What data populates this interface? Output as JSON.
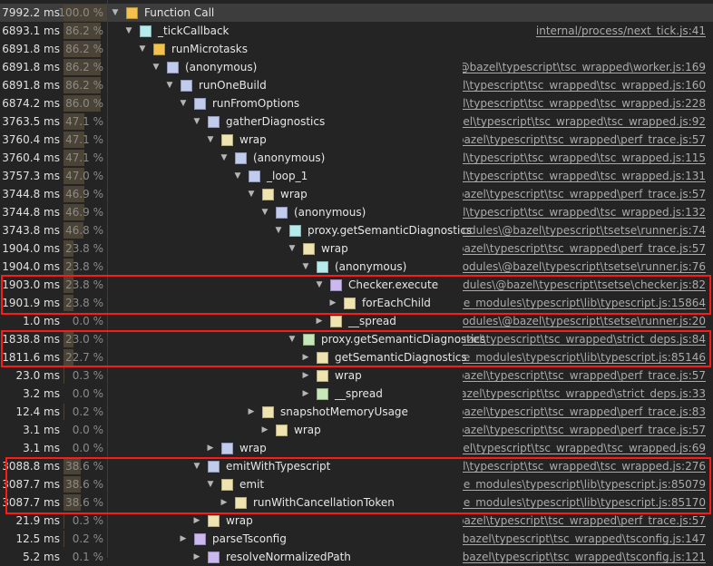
{
  "rows": [
    {
      "time": "7992.2 ms",
      "pct": "100.0 %",
      "pct_value": 100.0,
      "name": "Function Call",
      "src": "",
      "icon": "folder-yellow",
      "level": 0
    },
    {
      "time": "6893.1 ms",
      "pct": "86.2 %",
      "pct_value": 86.2,
      "name": "_tickCallback",
      "src": "internal/process/next_tick.js:41",
      "icon": "function-teal",
      "level": 1
    },
    {
      "time": "6891.8 ms",
      "pct": "86.2 %",
      "pct_value": 86.2,
      "name": "runMicrotasks",
      "src": "",
      "icon": "folder-yellow",
      "level": 2
    },
    {
      "time": "6891.8 ms",
      "pct": "86.2 %",
      "pct_value": 86.2,
      "name": "(anonymous)",
      "src": "les\\@bazel\\typescript\\tsc_wrapped\\worker.js:169",
      "icon": "function-blue",
      "level": 3
    },
    {
      "time": "6891.8 ms",
      "pct": "86.2 %",
      "pct_value": 86.2,
      "name": "runOneBuild",
      "src": "bazel\\typescript\\tsc_wrapped\\tsc_wrapped.js:160",
      "icon": "function-blue",
      "level": 4
    },
    {
      "time": "6874.2 ms",
      "pct": "86.0 %",
      "pct_value": 86.0,
      "name": "runFromOptions",
      "src": "bazel\\typescript\\tsc_wrapped\\tsc_wrapped.js:228",
      "icon": "function-blue",
      "level": 5
    },
    {
      "time": "3763.5 ms",
      "pct": "47.1 %",
      "pct_value": 47.1,
      "name": "gatherDiagnostics",
      "src": "@bazel\\typescript\\tsc_wrapped\\tsc_wrapped.js:92",
      "icon": "function-blue",
      "level": 6
    },
    {
      "time": "3760.4 ms",
      "pct": "47.1 %",
      "pct_value": 47.1,
      "name": "wrap",
      "src": "s\\@bazel\\typescript\\tsc_wrapped\\perf_trace.js:57",
      "icon": "function-yellow",
      "level": 7
    },
    {
      "time": "3760.4 ms",
      "pct": "47.1 %",
      "pct_value": 47.1,
      "name": "(anonymous)",
      "src": "bazel\\typescript\\tsc_wrapped\\tsc_wrapped.js:115",
      "icon": "function-blue",
      "level": 8
    },
    {
      "time": "3757.3 ms",
      "pct": "47.0 %",
      "pct_value": 47.0,
      "name": "_loop_1",
      "src": "bazel\\typescript\\tsc_wrapped\\tsc_wrapped.js:131",
      "icon": "function-blue",
      "level": 9
    },
    {
      "time": "3744.8 ms",
      "pct": "46.9 %",
      "pct_value": 46.9,
      "name": "wrap",
      "src": "s\\@bazel\\typescript\\tsc_wrapped\\perf_trace.js:57",
      "icon": "function-yellow",
      "level": 10
    },
    {
      "time": "3744.8 ms",
      "pct": "46.9 %",
      "pct_value": 46.9,
      "name": "(anonymous)",
      "src": "bazel\\typescript\\tsc_wrapped\\tsc_wrapped.js:132",
      "icon": "function-blue",
      "level": 11
    },
    {
      "time": "3743.8 ms",
      "pct": "46.8 %",
      "pct_value": 46.8,
      "name": "proxy.getSemanticDiagnostics",
      "src": "e_modules\\@bazel\\typescript\\tsetse\\runner.js:74",
      "icon": "function-teal",
      "level": 12
    },
    {
      "time": "1904.0 ms",
      "pct": "23.8 %",
      "pct_value": 23.8,
      "name": "wrap",
      "src": "s\\@bazel\\typescript\\tsc_wrapped\\perf_trace.js:57",
      "icon": "function-yellow",
      "level": 13
    },
    {
      "time": "1904.0 ms",
      "pct": "23.8 %",
      "pct_value": 23.8,
      "name": "(anonymous)",
      "src": "e_modules\\@bazel\\typescript\\tsetse\\runner.js:76",
      "icon": "function-teal",
      "level": 14
    },
    {
      "time": "1903.0 ms",
      "pct": "23.8 %",
      "pct_value": 23.8,
      "name": "Checker.execute",
      "src": "_modules\\@bazel\\typescript\\tsetse\\checker.js:82",
      "icon": "function-purple",
      "level": 15
    },
    {
      "time": "1901.9 ms",
      "pct": "23.8 %",
      "pct_value": 23.8,
      "name": "forEachChild",
      "src": "\\node_modules\\typescript\\lib\\typescript.js:15864",
      "icon": "function-yellow",
      "level": 16
    },
    {
      "time": "1.0 ms",
      "pct": "0.0 %",
      "pct_value": 0.0,
      "name": "__spread",
      "src": "e_modules\\@bazel\\typescript\\tsetse\\runner.js:20",
      "icon": "function-yellow",
      "level": 15
    },
    {
      "time": "1838.8 ms",
      "pct": "23.0 %",
      "pct_value": 23.0,
      "name": "proxy.getSemanticDiagnostics",
      "src": "\\@bazel\\typescript\\tsc_wrapped\\strict_deps.js:84",
      "icon": "function-green",
      "level": 13
    },
    {
      "time": "1811.6 ms",
      "pct": "22.7 %",
      "pct_value": 22.7,
      "name": "getSemanticDiagnostics",
      "src": "\\node_modules\\typescript\\lib\\typescript.js:85146",
      "icon": "function-yellow",
      "level": 14
    },
    {
      "time": "23.0 ms",
      "pct": "0.3 %",
      "pct_value": 0.3,
      "name": "wrap",
      "src": "s\\@bazel\\typescript\\tsc_wrapped\\perf_trace.js:57",
      "icon": "function-yellow",
      "level": 14
    },
    {
      "time": "3.2 ms",
      "pct": "0.0 %",
      "pct_value": 0.0,
      "name": "__spread",
      "src": "\\@bazel\\typescript\\tsc_wrapped\\strict_deps.js:33",
      "icon": "function-green",
      "level": 14
    },
    {
      "time": "12.4 ms",
      "pct": "0.2 %",
      "pct_value": 0.2,
      "name": "snapshotMemoryUsage",
      "src": "s\\@bazel\\typescript\\tsc_wrapped\\perf_trace.js:83",
      "icon": "function-yellow",
      "level": 10
    },
    {
      "time": "3.1 ms",
      "pct": "0.0 %",
      "pct_value": 0.0,
      "name": "wrap",
      "src": "s\\@bazel\\typescript\\tsc_wrapped\\perf_trace.js:57",
      "icon": "function-yellow",
      "level": 11
    },
    {
      "time": "3.1 ms",
      "pct": "0.0 %",
      "pct_value": 0.0,
      "name": "wrap",
      "src": "bazel\\typescript\\tsc_wrapped\\tsc_wrapped.js:69",
      "icon": "function-blue",
      "level": 7
    },
    {
      "time": "3088.8 ms",
      "pct": "38.6 %",
      "pct_value": 38.6,
      "name": "emitWithTypescript",
      "src": "bazel\\typescript\\tsc_wrapped\\tsc_wrapped.js:276",
      "icon": "function-blue",
      "level": 6
    },
    {
      "time": "3087.7 ms",
      "pct": "38.6 %",
      "pct_value": 38.6,
      "name": "emit",
      "src": "\\node_modules\\typescript\\lib\\typescript.js:85079",
      "icon": "function-yellow",
      "level": 7
    },
    {
      "time": "3087.7 ms",
      "pct": "38.6 %",
      "pct_value": 38.6,
      "name": "runWithCancellationToken",
      "src": "\\node_modules\\typescript\\lib\\typescript.js:85170",
      "icon": "function-yellow",
      "level": 8
    },
    {
      "time": "21.9 ms",
      "pct": "0.3 %",
      "pct_value": 0.3,
      "name": "wrap",
      "src": "s\\@bazel\\typescript\\tsc_wrapped\\perf_trace.js:57",
      "icon": "function-yellow",
      "level": 6
    },
    {
      "time": "12.5 ms",
      "pct": "0.2 %",
      "pct_value": 0.2,
      "name": "parseTsconfig",
      "src": "rs\\@bazel\\typescript\\tsc_wrapped\\tsconfig.js:147",
      "icon": "function-purple",
      "level": 5
    },
    {
      "time": "5.2 ms",
      "pct": "0.1 %",
      "pct_value": 0.1,
      "name": "resolveNormalizedPath",
      "src": "es\\@bazel\\typescript\\tsc_wrapped\\tsconfig.js:121",
      "icon": "function-purple",
      "level": 6
    }
  ],
  "expanded": [
    true,
    true,
    true,
    true,
    true,
    true,
    true,
    true,
    true,
    true,
    true,
    true,
    true,
    true,
    true,
    true,
    false,
    false,
    true,
    false,
    false,
    false,
    false,
    false,
    false,
    true,
    true,
    false,
    false,
    false,
    false
  ],
  "colors": {
    "background": "#242424",
    "selection": "#3d3d3d",
    "highlight_box": "#ff1a1a",
    "folder-yellow": "#f2c14e",
    "function-yellow": "#efe3b0",
    "function-teal": "#b6ebeb",
    "function-blue": "#c1cbed",
    "function-purple": "#cbb8ee",
    "function-green": "#c6e8b8"
  }
}
